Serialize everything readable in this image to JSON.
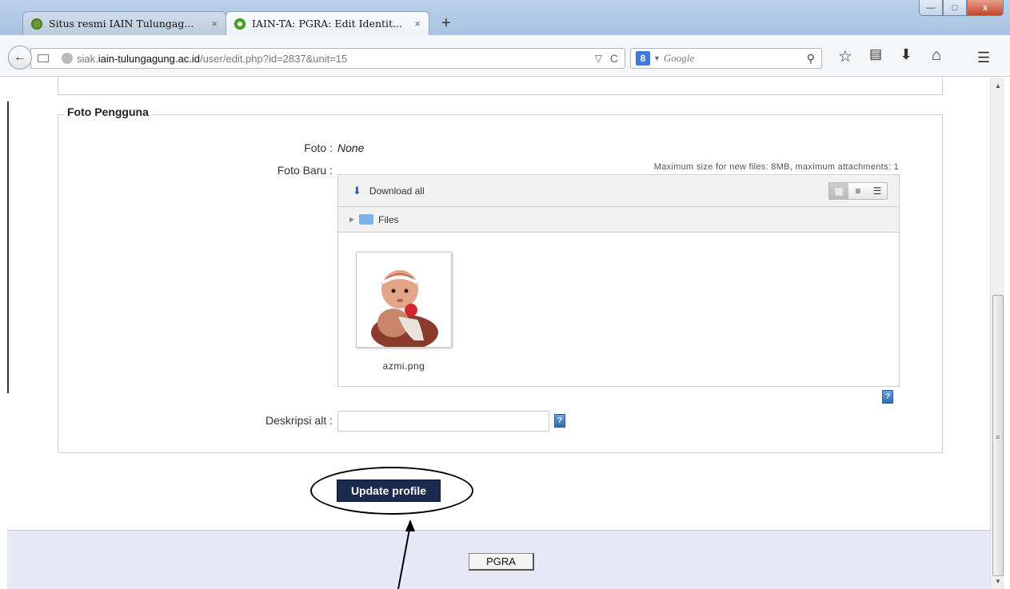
{
  "browser": {
    "tabs": [
      {
        "title": "Situs resmi IAIN Tulungag...",
        "active": false
      },
      {
        "title": "IAIN-TA: PGRA: Edit Identit...",
        "active": true
      }
    ],
    "close_glyph": "×",
    "new_tab_glyph": "+",
    "url": {
      "prefix": "siak.",
      "host": "iain-tulungagung.ac.id",
      "path": "/user/edit.php?id=2837&unit=15"
    },
    "search_placeholder": "Google",
    "window_controls": {
      "minimize": "—",
      "maximize": "□",
      "close": "x"
    }
  },
  "form": {
    "section_title": "Foto Pengguna",
    "foto_label": "Foto :",
    "foto_value": "None",
    "foto_baru_label": "Foto Baru :",
    "max_info": "Maximum size for new files: 8MB, maximum attachments: 1",
    "filepicker": {
      "download_all": "Download all",
      "path_label": "Files",
      "file_name": "azmi.png"
    },
    "alt_label": "Deskripsi alt :",
    "alt_value": "",
    "help_glyph": "?",
    "submit_label": "Update profile"
  },
  "footer": {
    "home_button": "PGRA"
  },
  "colors": {
    "submit_bg": "#1d2a4f",
    "footer_bg": "#e7e8f6",
    "titlebar": "#b9d1ea",
    "close_button": "#c5432a"
  },
  "icons": {
    "back": "arrow-left-icon",
    "star": "star-icon",
    "bookmarks": "bookmarks-icon",
    "download": "download-icon",
    "home": "home-icon",
    "menu": "hamburger-menu-icon"
  }
}
